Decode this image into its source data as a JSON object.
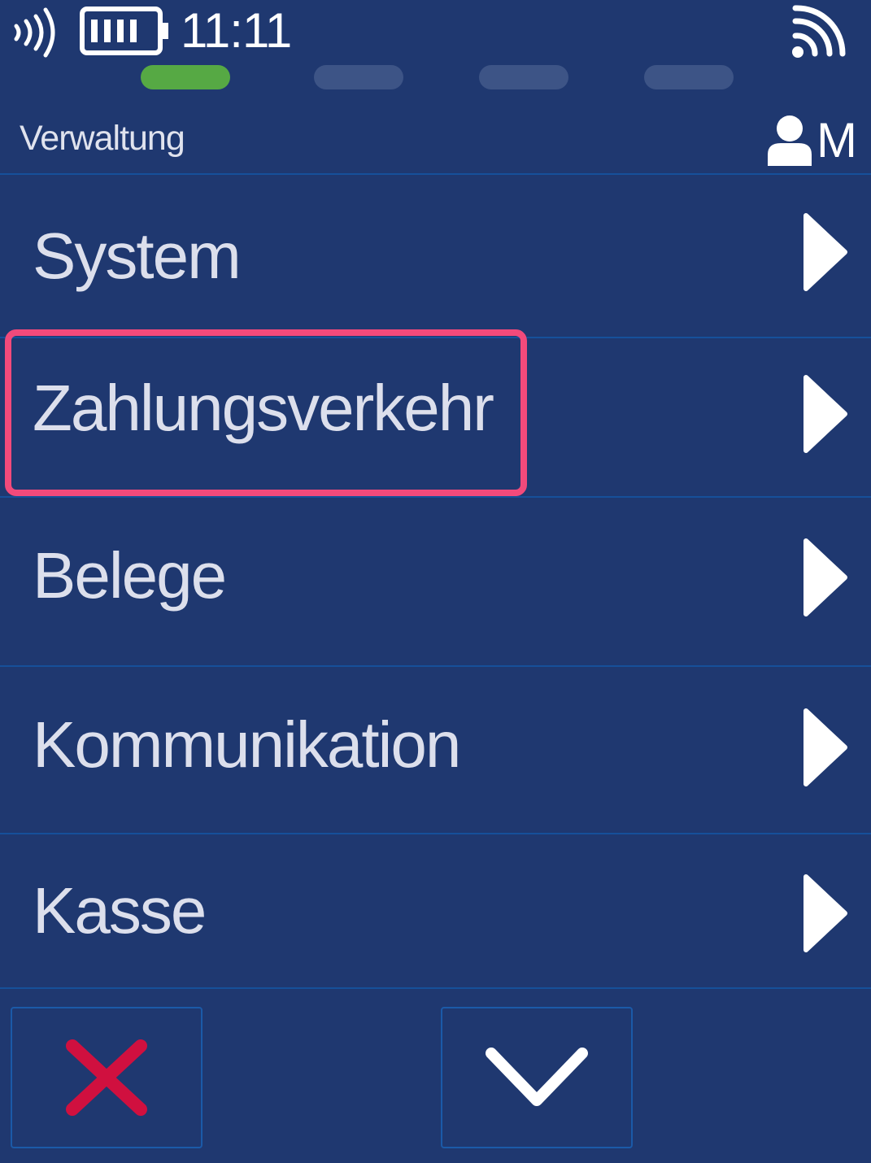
{
  "status_bar": {
    "time": "11:11",
    "icons": [
      "nfc-icon",
      "battery-icon",
      "signal-icon"
    ]
  },
  "progress": {
    "steps": 4,
    "active_step": 1,
    "active_color": "#56a944",
    "inactive_color": "#3d5486"
  },
  "header": {
    "title": "Verwaltung",
    "user_initial": "M",
    "user_icon": "user-icon"
  },
  "menu": {
    "items": [
      {
        "label": "System",
        "icon": "chevron-right-icon"
      },
      {
        "label": "Zahlungsverkehr",
        "icon": "chevron-right-icon"
      },
      {
        "label": "Belege",
        "icon": "chevron-right-icon"
      },
      {
        "label": "Kommunikation",
        "icon": "chevron-right-icon"
      },
      {
        "label": "Kasse",
        "icon": "chevron-right-icon"
      }
    ]
  },
  "bottom_bar": {
    "cancel_icon": "close-icon",
    "down_icon": "chevron-down-icon"
  },
  "colors": {
    "background": "#1f3870",
    "divider": "#16509a",
    "highlight": "#f24a7b",
    "cancel": "#d0103f"
  }
}
